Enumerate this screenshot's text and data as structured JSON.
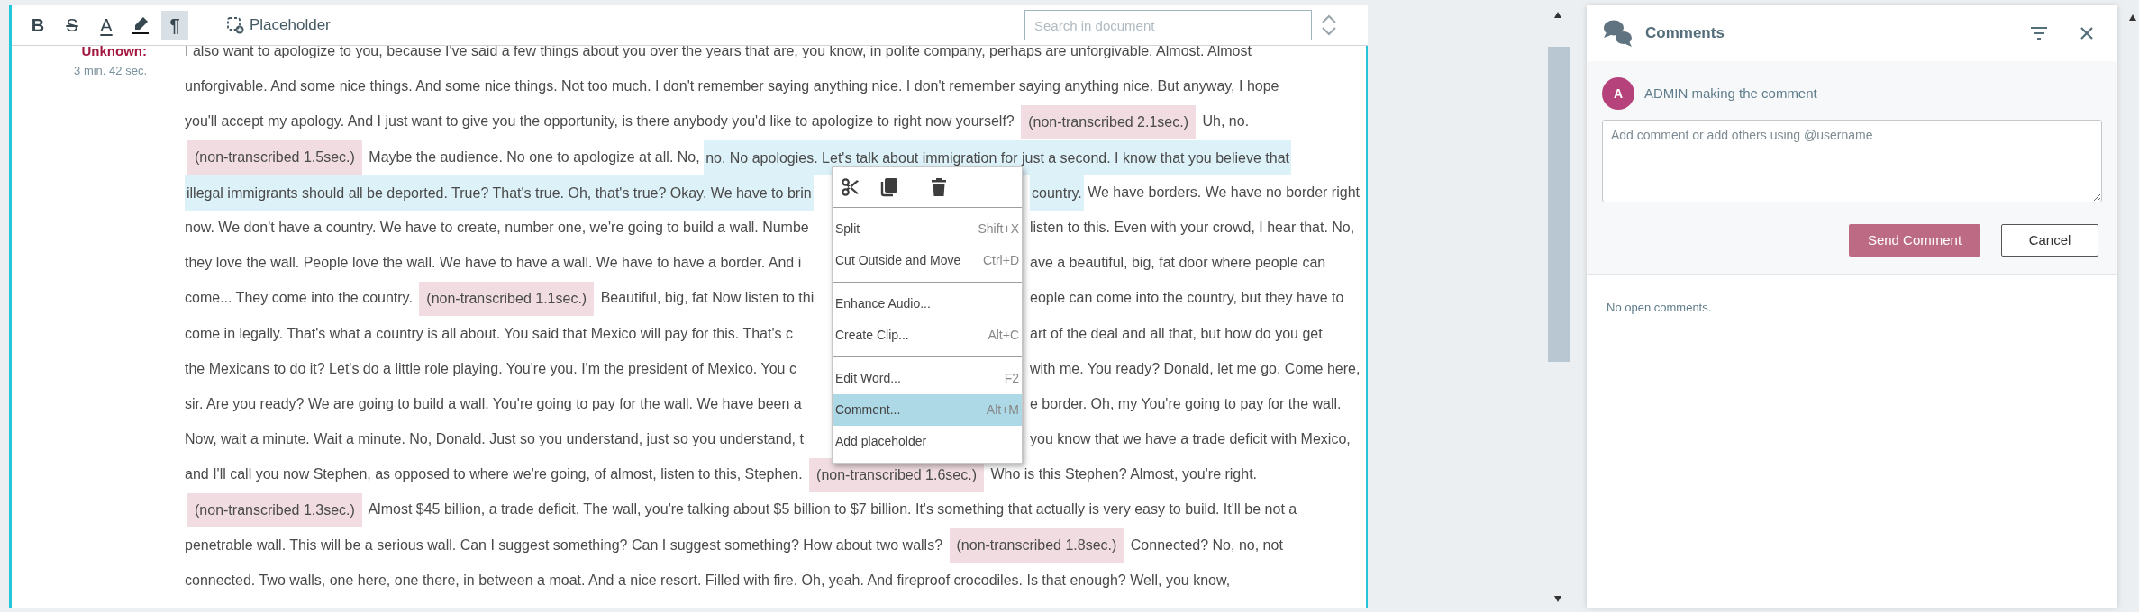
{
  "toolbar": {
    "format_buttons": [
      {
        "kind": "bold",
        "glyph": "B",
        "selected": false
      },
      {
        "kind": "strike",
        "glyph": "S",
        "selected": false
      },
      {
        "kind": "font_color",
        "glyph": "A",
        "selected": false
      },
      {
        "kind": "highlight",
        "selected": false
      },
      {
        "kind": "paragraph",
        "glyph": "¶",
        "selected": true
      }
    ],
    "placeholder_button": "Placeholder",
    "search": {
      "placeholder": "Search in document"
    }
  },
  "transcript": {
    "speaker": "Unknown:",
    "duration": "3 min. 42 sec.",
    "lines": [
      {
        "segments": [
          {
            "kind": "text",
            "text": "I also want to apologize to you, because I've said a few things about you over the years that are, you know, in polite company, perhaps are unforgivable. Almost. Almost"
          }
        ]
      },
      {
        "segments": [
          {
            "kind": "text",
            "text": "unforgivable. And some nice things. And some nice things. Not too much. I don't remember saying anything nice. I don't remember saying anything nice. But anyway, I hope"
          }
        ]
      },
      {
        "segments": [
          {
            "kind": "text",
            "text": "you'll accept my apology. And I just want to give you the opportunity, is there anybody you'd like to apologize to right now yourself?"
          },
          {
            "kind": "gap",
            "text": "(non-transcribed 2.1sec.)"
          },
          {
            "kind": "text",
            "text": "Uh, no."
          }
        ]
      },
      {
        "segments": [
          {
            "kind": "gap",
            "text": "(non-transcribed 1.5sec.)"
          },
          {
            "kind": "text",
            "text": "Maybe the audience. No one to apologize at all. No,"
          },
          {
            "kind": "selection",
            "text": "no. No apologies. Let's talk about immigration for just a second. I know that you believe that"
          }
        ]
      },
      {
        "segments": [
          {
            "kind": "selection",
            "text": "illegal immigrants should all be deported. True? That's true. Oh, that's true? Okay. We have to brin"
          }
        ],
        "after_menu": [
          {
            "kind": "selection",
            "text": "country."
          },
          {
            "kind": "text",
            "text": "We have borders. We have no border right"
          }
        ]
      },
      {
        "segments": [
          {
            "kind": "text",
            "text": "now. We don't have a country. We have to create, number one, we're going to build a wall. Numbe"
          }
        ],
        "after_menu": [
          {
            "kind": "text",
            "text": "listen to this. Even with your crowd, I hear that. No,"
          }
        ]
      },
      {
        "segments": [
          {
            "kind": "text",
            "text": "they love the wall. People love the wall. We have to have a wall. We have to have a border. And i"
          }
        ],
        "after_menu": [
          {
            "kind": "text",
            "text": "ave a beautiful, big, fat door where people can"
          }
        ]
      },
      {
        "segments": [
          {
            "kind": "text",
            "text": "come... They come into the country."
          },
          {
            "kind": "gap",
            "text": "(non-transcribed 1.1sec.)"
          },
          {
            "kind": "text",
            "text": "Beautiful, big, fat Now listen to thi"
          }
        ],
        "after_menu": [
          {
            "kind": "text",
            "text": "eople can come into the country, but they have to"
          }
        ]
      },
      {
        "segments": [
          {
            "kind": "text",
            "text": "come in legally. That's what a country is all about. You said that Mexico will pay for this. That's c"
          }
        ],
        "after_menu": [
          {
            "kind": "text",
            "text": "art of the deal and all that, but how do you get"
          }
        ]
      },
      {
        "segments": [
          {
            "kind": "text",
            "text": "the Mexicans to do it? Let's do a little role playing. You're you. I'm the president of Mexico. You c"
          }
        ],
        "after_menu": [
          {
            "kind": "text",
            "text": "with me. You ready? Donald, let me go. Come here,"
          }
        ]
      },
      {
        "segments": [
          {
            "kind": "text",
            "text": "sir. Are you ready? We are going to build a wall. You're going to pay for the wall. We have been a"
          }
        ],
        "after_menu": [
          {
            "kind": "text",
            "text": "e border. Oh, my You're going to pay for the wall."
          }
        ]
      },
      {
        "segments": [
          {
            "kind": "text",
            "text": "Now, wait a minute. Wait a minute. No, Donald. Just so you understand, just so you understand, t"
          }
        ],
        "after_menu": [
          {
            "kind": "text",
            "text": "you know that we have a trade deficit with Mexico,"
          }
        ]
      },
      {
        "segments": [
          {
            "kind": "text",
            "text": "and I'll call you now Stephen, as opposed to where we're going, of almost, listen to this, Stephen."
          },
          {
            "kind": "gap",
            "text": "(non-transcribed 1.6sec.)"
          },
          {
            "kind": "text",
            "text": "Who is this Stephen? Almost, you're right."
          }
        ]
      },
      {
        "segments": [
          {
            "kind": "gap",
            "text": "(non-transcribed 1.3sec.)"
          },
          {
            "kind": "text",
            "text": "Almost $45 billion, a trade deficit. The wall, you're talking about $5 billion to $7 billion. It's something that actually is very easy to build. It'll be not a"
          }
        ]
      },
      {
        "segments": [
          {
            "kind": "text",
            "text": "penetrable wall. This will be a serious wall. Can I suggest something? Can I suggest something? How about two walls?"
          },
          {
            "kind": "gap",
            "text": "(non-transcribed 1.8sec.)"
          },
          {
            "kind": "text",
            "text": "Connected? No, no, not"
          }
        ]
      },
      {
        "segments": [
          {
            "kind": "text",
            "text": "connected. Two walls, one here, one there, in between a moat. And a nice resort. Filled with fire. Oh, yeah. And fireproof crocodiles. Is that enough? Well, you know,"
          }
        ]
      }
    ]
  },
  "context_menu": {
    "groups": [
      [
        {
          "label": "Split",
          "shortcut": "Shift+X",
          "selected": false
        },
        {
          "label": "Cut Outside and Move",
          "shortcut": "Ctrl+D",
          "selected": false
        }
      ],
      [
        {
          "label": "Enhance Audio...",
          "selected": false
        },
        {
          "label": "Create Clip...",
          "shortcut": "Alt+C",
          "selected": false
        }
      ],
      [
        {
          "label": "Edit Word...",
          "shortcut": "F2",
          "selected": false
        },
        {
          "label": "Comment...",
          "shortcut": "Alt+M",
          "selected": true
        },
        {
          "label": "Add placeholder",
          "selected": false
        }
      ]
    ]
  },
  "comments": {
    "title": "Comments",
    "author_initial": "A",
    "author_line": "ADMIN making the comment",
    "input": {
      "placeholder": "Add comment or add others using @username"
    },
    "send_button": "Send Comment",
    "cancel_button": "Cancel",
    "empty_message": "No open comments."
  }
}
